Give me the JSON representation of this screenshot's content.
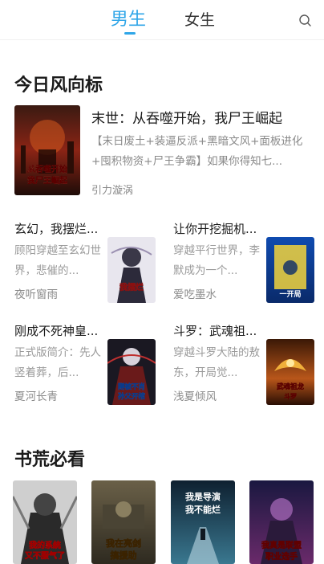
{
  "header": {
    "tabs": [
      {
        "label": "男生",
        "active": true
      },
      {
        "label": "女生",
        "active": false
      }
    ],
    "search_icon": "search-icon",
    "accent_color": "#2fa6e8"
  },
  "today": {
    "section_title": "今日风向标",
    "featured": {
      "title": "末世：从吞噬开始，我尸王崛起",
      "description": "【末日废土+装逼反派+黑暗文风+面板进化+囤积物资+尸王争霸】如果你得知七...",
      "author": "引力漩涡",
      "cover_text": [
        "从吞噬开始",
        "我尸王崛起"
      ]
    },
    "books": [
      {
        "title": "玄幻，我摆烂...",
        "description": "顾阳穿越至玄幻世界，悲催的...",
        "author": "夜听窗雨",
        "cover_text": [
          "我摆烂"
        ]
      },
      {
        "title": "让你开挖掘机...",
        "description": "穿越平行世界，李默成为一个...",
        "author": "爱吃墨水",
        "cover_text": [
          "一开局"
        ]
      },
      {
        "title": "刚成不死神皇...",
        "description": "正式版简介：先人竖着葬，后...",
        "author": "夏河长青",
        "cover_text": [
          "刚被不肖",
          "孙父开棺"
        ]
      },
      {
        "title": "斗罗：武魂祖...",
        "description": "穿越斗罗大陆的敖东，开局觉...",
        "author": "浅夏倾风",
        "cover_text": [
          "武魂祖龙",
          "斗罗"
        ]
      }
    ]
  },
  "must_read": {
    "section_title": "书荒必看",
    "covers": [
      {
        "cover_text": [
          "我的系统",
          "又不服气了"
        ]
      },
      {
        "cover_text": [
          "我在亮剑",
          "搞援助"
        ]
      },
      {
        "cover_text": [
          "我是导演",
          "我不能烂"
        ]
      },
      {
        "cover_text": [
          "我真是联盟",
          "职业选手"
        ]
      }
    ]
  }
}
